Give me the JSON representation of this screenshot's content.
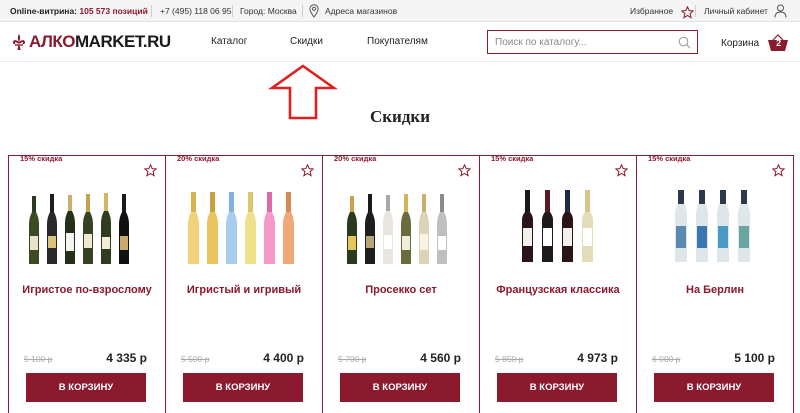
{
  "topbar": {
    "showcase_label": "Online-витрина:",
    "showcase_count": "105 573 позиций",
    "phone": "+7 (495) 118 06 95",
    "city": "Город: Москва",
    "stores": "Адреса магазинов",
    "favorites": "Избранное",
    "account": "Личный кабинет"
  },
  "header": {
    "logo_left": "АЛКО",
    "logo_right": "MARKET.RU",
    "nav": [
      "Каталог",
      "Скидки",
      "Покупателям"
    ],
    "search_placeholder": "Поиск по каталогу...",
    "cart_label": "Корзина",
    "cart_count": "2"
  },
  "section_title": "Скидки",
  "colors": {
    "accent": "#8b1a2e",
    "annotation_arrow": "#e02020"
  },
  "cards": [
    {
      "discount": "15% скидка",
      "name": "Игристое по-взрослому",
      "old_price": "5 100 р",
      "price": "4 335 р",
      "button": "В КОРЗИНУ"
    },
    {
      "discount": "20% скидка",
      "name": "Игристый и игривый",
      "old_price": "5 500 р",
      "price": "4 400 р",
      "button": "В КОРЗИНУ"
    },
    {
      "discount": "20% скидка",
      "name": "Просекко сет",
      "old_price": "5 700 р",
      "price": "4 560 р",
      "button": "В КОРЗИНУ"
    },
    {
      "discount": "15% скидка",
      "name": "Французская классика",
      "old_price": "5 850 р",
      "price": "4 973 р",
      "button": "В КОРЗИНУ"
    },
    {
      "discount": "15% скидка",
      "name": "На Берлин",
      "old_price": "6 000 р",
      "price": "5 100 р",
      "button": "В КОРЗИНУ"
    }
  ]
}
